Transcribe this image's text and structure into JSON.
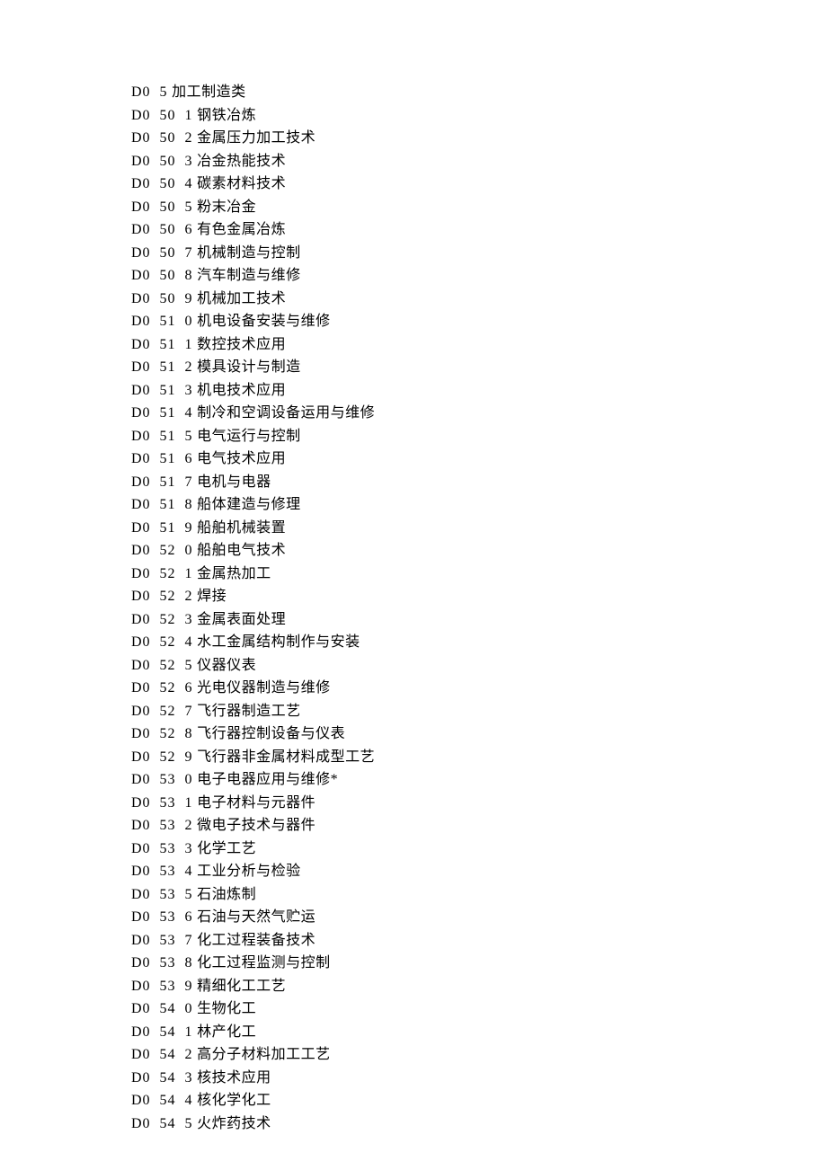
{
  "entries": [
    {
      "code": "D0  5",
      "text": "加工制造类"
    },
    {
      "code": "D0  50  1",
      "text": "钢铁冶炼"
    },
    {
      "code": "D0  50  2",
      "text": "金属压力加工技术"
    },
    {
      "code": "D0  50  3",
      "text": "冶金热能技术"
    },
    {
      "code": "D0  50  4",
      "text": "碳素材料技术"
    },
    {
      "code": "D0  50  5",
      "text": "粉末冶金"
    },
    {
      "code": "D0  50  6",
      "text": "有色金属冶炼"
    },
    {
      "code": "D0  50  7",
      "text": "机械制造与控制"
    },
    {
      "code": "D0  50  8",
      "text": "汽车制造与维修"
    },
    {
      "code": "D0  50  9",
      "text": "机械加工技术"
    },
    {
      "code": "D0  51  0",
      "text": "机电设备安装与维修"
    },
    {
      "code": "D0  51  1",
      "text": "数控技术应用"
    },
    {
      "code": "D0  51  2",
      "text": "模具设计与制造"
    },
    {
      "code": "D0  51  3",
      "text": "机电技术应用"
    },
    {
      "code": "D0  51  4",
      "text": "制冷和空调设备运用与维修"
    },
    {
      "code": "D0  51  5",
      "text": "电气运行与控制"
    },
    {
      "code": "D0  51  6",
      "text": "电气技术应用"
    },
    {
      "code": "D0  51  7",
      "text": "电机与电器"
    },
    {
      "code": "D0  51  8",
      "text": "船体建造与修理"
    },
    {
      "code": "D0  51  9",
      "text": "船舶机械装置"
    },
    {
      "code": "D0  52  0",
      "text": "船舶电气技术"
    },
    {
      "code": "D0  52  1",
      "text": "金属热加工"
    },
    {
      "code": "D0  52  2",
      "text": "焊接"
    },
    {
      "code": "D0  52  3",
      "text": "金属表面处理"
    },
    {
      "code": "D0  52  4",
      "text": "水工金属结构制作与安装"
    },
    {
      "code": "D0  52  5",
      "text": "仪器仪表"
    },
    {
      "code": "D0  52  6",
      "text": "光电仪器制造与维修"
    },
    {
      "code": "D0  52  7",
      "text": "飞行器制造工艺"
    },
    {
      "code": "D0  52  8",
      "text": "飞行器控制设备与仪表"
    },
    {
      "code": "D0  52  9",
      "text": "飞行器非金属材料成型工艺"
    },
    {
      "code": "D0  53  0",
      "text": "电子电器应用与维修*"
    },
    {
      "code": "D0  53  1",
      "text": "电子材料与元器件"
    },
    {
      "code": "D0  53  2",
      "text": "微电子技术与器件"
    },
    {
      "code": "D0  53  3",
      "text": "化学工艺"
    },
    {
      "code": "D0  53  4",
      "text": "工业分析与检验"
    },
    {
      "code": "D0  53  5",
      "text": "石油炼制"
    },
    {
      "code": "D0  53  6",
      "text": "石油与天然气贮运"
    },
    {
      "code": "D0  53  7",
      "text": "化工过程装备技术"
    },
    {
      "code": "D0  53  8",
      "text": "化工过程监测与控制"
    },
    {
      "code": "D0  53  9",
      "text": "精细化工工艺"
    },
    {
      "code": "D0  54  0",
      "text": "生物化工"
    },
    {
      "code": "D0  54  1",
      "text": "林产化工"
    },
    {
      "code": "D0  54  2",
      "text": "高分子材料加工工艺"
    },
    {
      "code": "D0  54  3",
      "text": "核技术应用"
    },
    {
      "code": "D0  54  4",
      "text": "核化学化工"
    },
    {
      "code": "D0  54  5",
      "text": "火炸药技术"
    }
  ]
}
